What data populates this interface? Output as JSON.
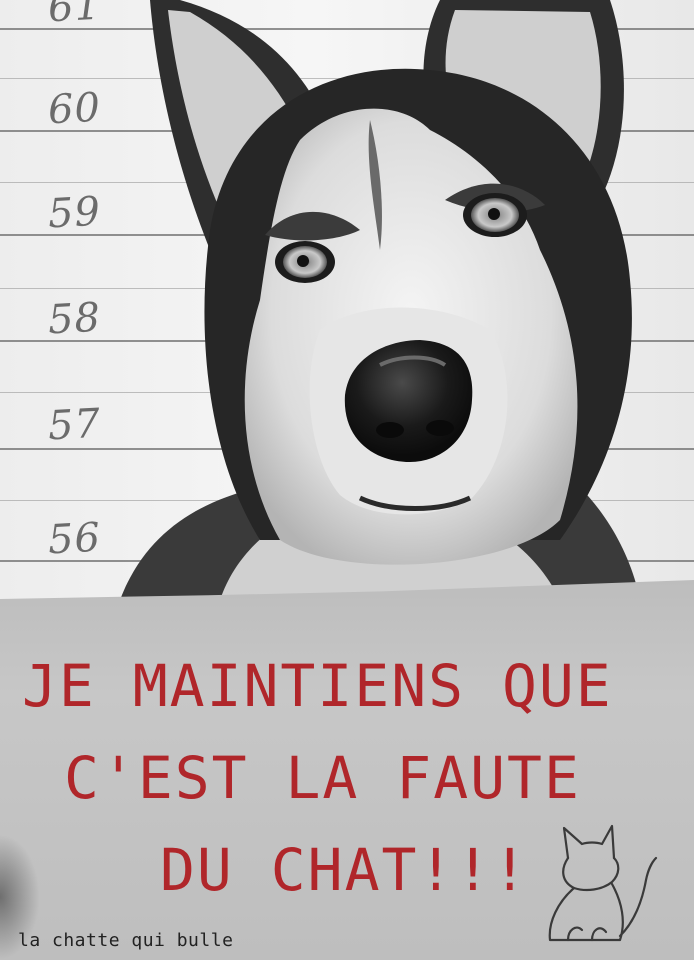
{
  "height_marks": [
    "61",
    "60",
    "59",
    "58",
    "57",
    "56"
  ],
  "sign": {
    "lines": [
      "JE MAINTIENS QUE",
      "C'EST LA FAUTE",
      "DU CHAT!!!"
    ],
    "signature": "la chatte qui bulle"
  },
  "colors": {
    "sign_text": "#b0262a",
    "cardboard": "#c3c3c3",
    "wall": "#efefef"
  }
}
